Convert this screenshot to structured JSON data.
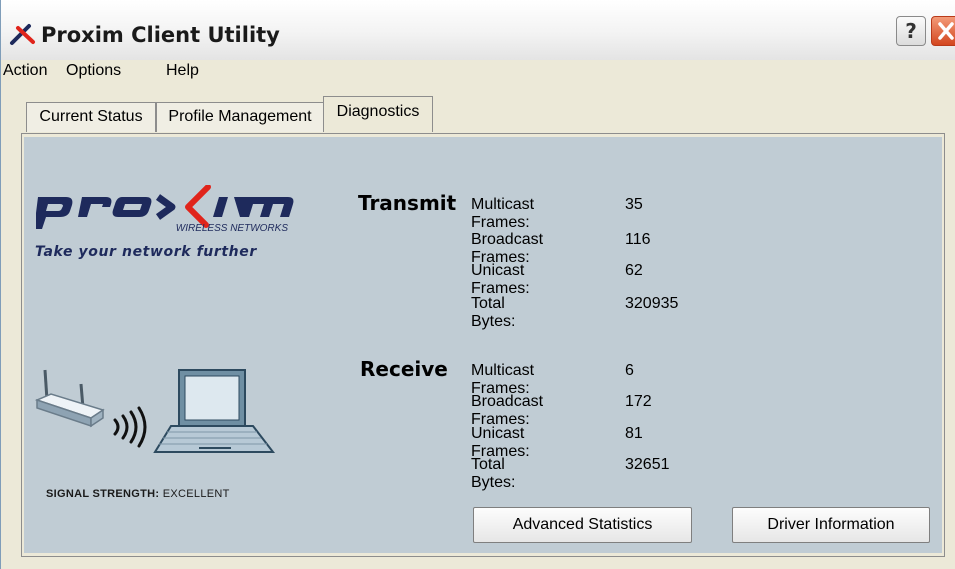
{
  "window": {
    "title": "Proxim Client Utility",
    "help_glyph": "?"
  },
  "menu": [
    "Action",
    "Options",
    "Help"
  ],
  "tabs": [
    {
      "label": "Current Status",
      "active": false
    },
    {
      "label": "Profile Management",
      "active": false
    },
    {
      "label": "Diagnostics",
      "active": true
    }
  ],
  "brand": {
    "logo_text": "proxim",
    "logo_sub": "WIRELESS NETWORKS",
    "tagline": "Take your network further"
  },
  "signal": {
    "label": "SIGNAL STRENGTH:",
    "value": "EXCELLENT"
  },
  "transmit": {
    "title": "Transmit",
    "rows": [
      {
        "label": "Multicast Frames:",
        "value": "35"
      },
      {
        "label": "Broadcast Frames:",
        "value": "116"
      },
      {
        "label": "Unicast Frames:",
        "value": "62"
      },
      {
        "label": "Total Bytes:",
        "value": "320935"
      }
    ]
  },
  "receive": {
    "title": "Receive",
    "rows": [
      {
        "label": "Multicast Frames:",
        "value": "6"
      },
      {
        "label": "Broadcast Frames:",
        "value": "172"
      },
      {
        "label": "Unicast Frames:",
        "value": "81"
      },
      {
        "label": "Total Bytes:",
        "value": "32651"
      }
    ]
  },
  "buttons": {
    "advanced_statistics": "Advanced Statistics",
    "driver_information": "Driver Information"
  },
  "colors": {
    "panel": "#c0ccd4",
    "brand_navy": "#1e2a5c",
    "brand_red": "#e0241b",
    "close_red": "#d3461f"
  }
}
